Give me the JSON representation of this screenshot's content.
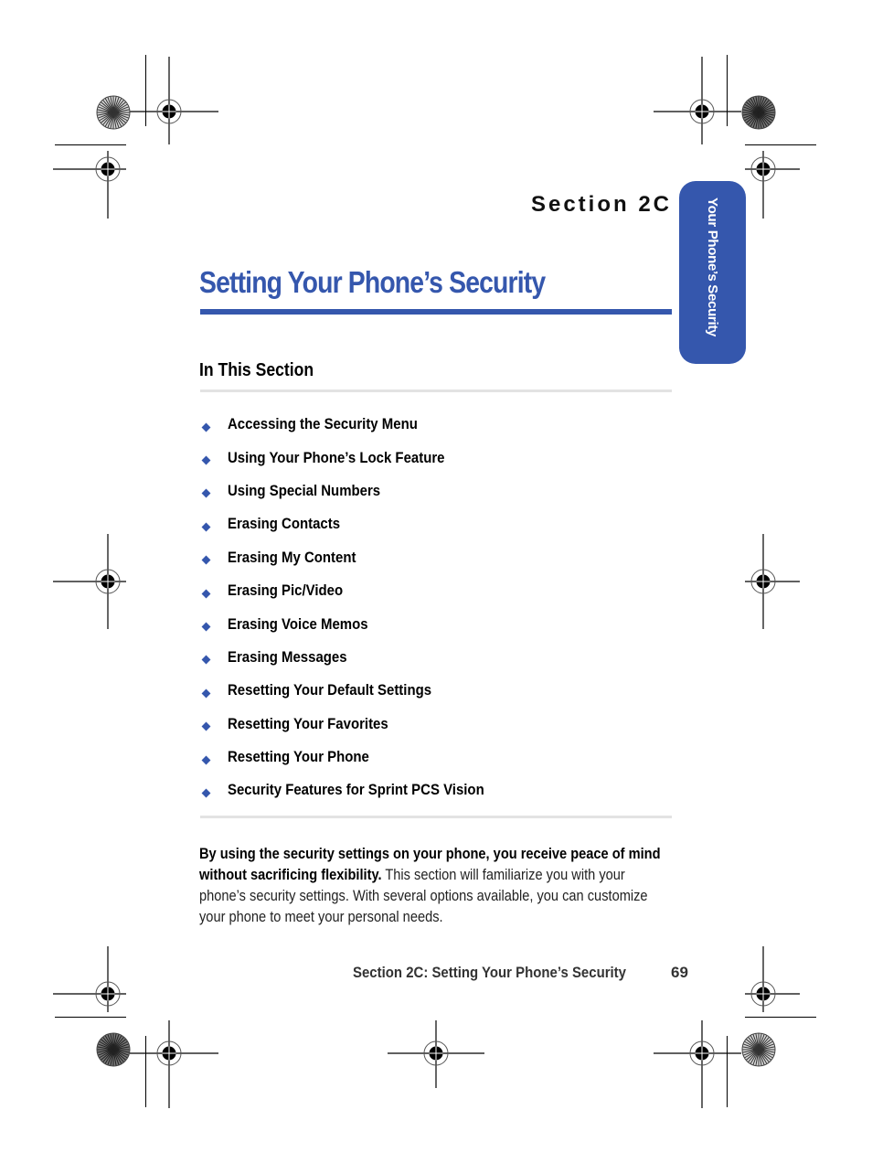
{
  "header": {
    "section_label": "Section 2C",
    "side_tab_label": "Your Phone’s Security"
  },
  "page_title": "Setting Your Phone’s Security",
  "in_this_section": {
    "heading": "In This Section",
    "items": [
      "Accessing the Security Menu",
      "Using Your Phone’s Lock Feature",
      "Using Special Numbers",
      "Erasing Contacts",
      "Erasing My Content",
      "Erasing Pic/Video",
      "Erasing Voice Memos",
      "Erasing Messages",
      "Resetting Your Default Settings",
      "Resetting Your Favorites",
      "Resetting Your Phone",
      "Security Features for Sprint PCS Vision"
    ]
  },
  "intro": {
    "bold": "By using the security settings on your phone, you receive peace of mind without sacrificing flexibility.",
    "regular": " This section will familiarize you with your phone’s security settings. With several options available, you can customize your phone to meet your personal needs."
  },
  "footer": {
    "title": "Section 2C: Setting Your Phone’s Security",
    "page_number": "69"
  },
  "colors": {
    "accent": "#3557ad",
    "rule_grey": "#e3e3e3"
  },
  "icons": {
    "bullet": "blue-diamond",
    "registration_mark": "crosshair-target",
    "color_wheel": "starburst-target"
  }
}
